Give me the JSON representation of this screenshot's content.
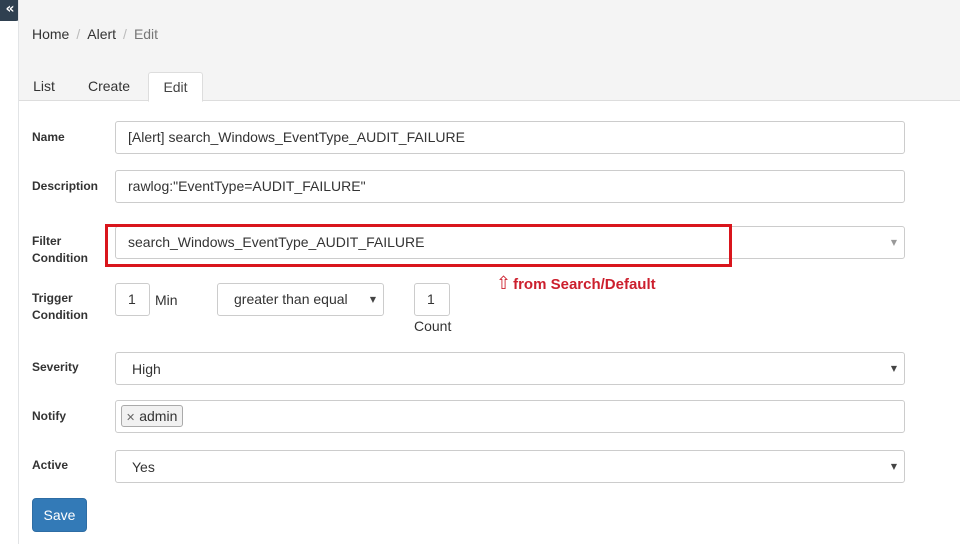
{
  "sidebar": {
    "toggle_glyph": "«",
    "toggle_icon": "double-chevron-left-icon"
  },
  "breadcrumb": {
    "home": "Home",
    "section": "Alert",
    "current": "Edit",
    "separator": "/"
  },
  "tabs": {
    "list": "List",
    "create": "Create",
    "edit": "Edit"
  },
  "form": {
    "name": {
      "label": "Name",
      "value": "[Alert] search_Windows_EventType_AUDIT_FAILURE"
    },
    "description": {
      "label": "Description",
      "value": "rawlog:\"EventType=AUDIT_FAILURE\""
    },
    "filter_condition": {
      "label": "Filter Condition",
      "value": "search_Windows_EventType_AUDIT_FAILURE"
    },
    "trigger_condition": {
      "label": "Trigger Condition",
      "minutes_value": "1",
      "minutes_unit": "Min",
      "operator": "greater than equal",
      "count_value": "1",
      "count_unit": "Count"
    },
    "severity": {
      "label": "Severity",
      "value": "High"
    },
    "notify": {
      "label": "Notify",
      "tags": [
        "admin"
      ]
    },
    "active": {
      "label": "Active",
      "value": "Yes"
    },
    "save_label": "Save"
  },
  "annotation": {
    "text": "from Search/Default",
    "color": "#cc1f2d",
    "highlight_color": "#d9151c"
  },
  "colors": {
    "primary": "#337ab7",
    "sidebar": "#2f4050"
  }
}
